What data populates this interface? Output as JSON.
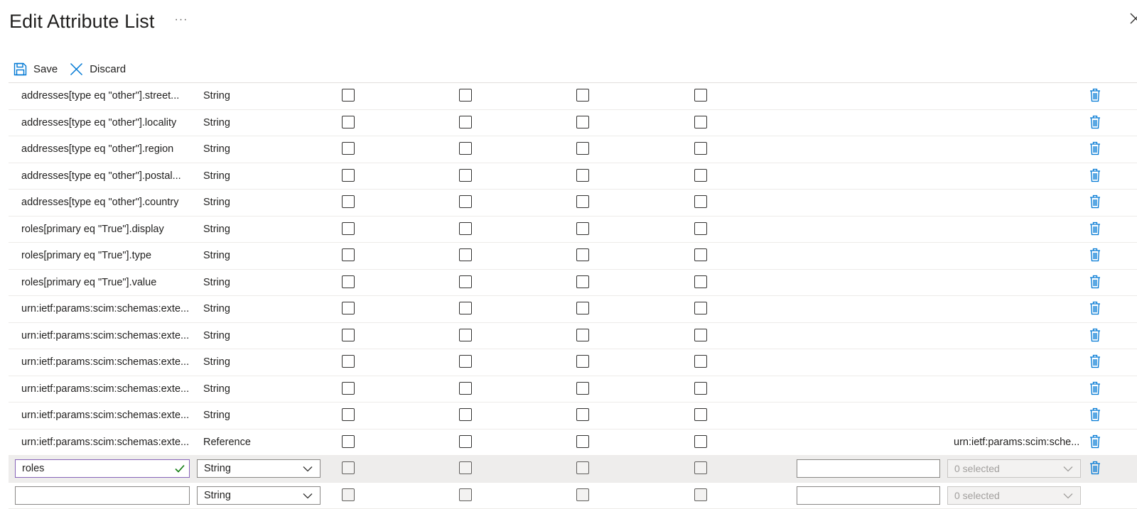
{
  "header": {
    "title": "Edit Attribute List",
    "more": "···"
  },
  "toolbar": {
    "save_label": "Save",
    "discard_label": "Discard"
  },
  "rows": [
    {
      "name": "addresses[type eq \"other\"].street...",
      "type": "String"
    },
    {
      "name": "addresses[type eq \"other\"].locality",
      "type": "String"
    },
    {
      "name": "addresses[type eq \"other\"].region",
      "type": "String"
    },
    {
      "name": "addresses[type eq \"other\"].postal...",
      "type": "String"
    },
    {
      "name": "addresses[type eq \"other\"].country",
      "type": "String"
    },
    {
      "name": "roles[primary eq \"True\"].display",
      "type": "String"
    },
    {
      "name": "roles[primary eq \"True\"].type",
      "type": "String"
    },
    {
      "name": "roles[primary eq \"True\"].value",
      "type": "String"
    },
    {
      "name": "urn:ietf:params:scim:schemas:exte...",
      "type": "String"
    },
    {
      "name": "urn:ietf:params:scim:schemas:exte...",
      "type": "String"
    },
    {
      "name": "urn:ietf:params:scim:schemas:exte...",
      "type": "String"
    },
    {
      "name": "urn:ietf:params:scim:schemas:exte...",
      "type": "String"
    },
    {
      "name": "urn:ietf:params:scim:schemas:exte...",
      "type": "String"
    },
    {
      "name": "urn:ietf:params:scim:schemas:exte...",
      "type": "Reference",
      "referenced": "urn:ietf:params:scim:sche..."
    }
  ],
  "edit_rows": [
    {
      "name_value": "roles",
      "type_value": "String",
      "multi_value": "0 selected",
      "valid": true
    },
    {
      "name_value": "",
      "type_value": "String",
      "multi_value": "0 selected",
      "valid": false
    }
  ],
  "colors": {
    "accent": "#0078d4",
    "valid": "#107c10",
    "focus_border": "#8764b8"
  },
  "icons": {
    "save": "save-icon",
    "discard": "close-icon",
    "delete": "trash-icon",
    "dropdown": "chevron-down-icon"
  }
}
